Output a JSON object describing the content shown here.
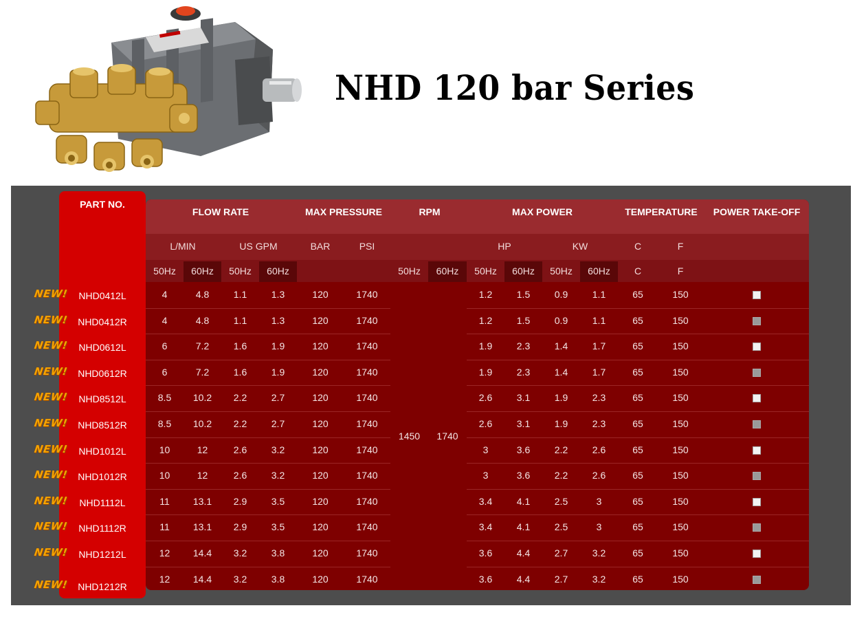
{
  "title": "NHD 120 bar Series",
  "badge": "NEW!",
  "headers": {
    "part_no": "PART NO.",
    "flow_rate": "FLOW RATE",
    "max_pressure": "MAX PRESSURE",
    "rpm": "RPM",
    "max_power": "MAX POWER",
    "temperature": "TEMPERATURE",
    "power_take_off": "POWER TAKE-OFF"
  },
  "units": {
    "lmin": "L/MIN",
    "usgpm": "US GPM",
    "bar": "BAR",
    "psi": "PSI",
    "hp": "HP",
    "kw": "KW",
    "c": "C",
    "f": "F"
  },
  "freq": {
    "hz50": "50Hz",
    "hz60": "60Hz"
  },
  "rpm_values": {
    "hz50": "1450",
    "hz60": "1740"
  },
  "colors": {
    "accent_red": "#d40000",
    "table_red": "#7e0000",
    "badge": "#f5a300"
  },
  "rows": [
    {
      "part": "NHD0412L",
      "lmin50": "4",
      "lmin60": "4.8",
      "gpm50": "1.1",
      "gpm60": "1.3",
      "bar": "120",
      "psi": "1740",
      "hp50": "1.2",
      "hp60": "1.5",
      "kw50": "0.9",
      "kw60": "1.1",
      "c": "65",
      "f": "150",
      "pto": "white"
    },
    {
      "part": "NHD0412R",
      "lmin50": "4",
      "lmin60": "4.8",
      "gpm50": "1.1",
      "gpm60": "1.3",
      "bar": "120",
      "psi": "1740",
      "hp50": "1.2",
      "hp60": "1.5",
      "kw50": "0.9",
      "kw60": "1.1",
      "c": "65",
      "f": "150",
      "pto": "gray"
    },
    {
      "part": "NHD0612L",
      "lmin50": "6",
      "lmin60": "7.2",
      "gpm50": "1.6",
      "gpm60": "1.9",
      "bar": "120",
      "psi": "1740",
      "hp50": "1.9",
      "hp60": "2.3",
      "kw50": "1.4",
      "kw60": "1.7",
      "c": "65",
      "f": "150",
      "pto": "white"
    },
    {
      "part": "NHD0612R",
      "lmin50": "6",
      "lmin60": "7.2",
      "gpm50": "1.6",
      "gpm60": "1.9",
      "bar": "120",
      "psi": "1740",
      "hp50": "1.9",
      "hp60": "2.3",
      "kw50": "1.4",
      "kw60": "1.7",
      "c": "65",
      "f": "150",
      "pto": "gray"
    },
    {
      "part": "NHD8512L",
      "lmin50": "8.5",
      "lmin60": "10.2",
      "gpm50": "2.2",
      "gpm60": "2.7",
      "bar": "120",
      "psi": "1740",
      "hp50": "2.6",
      "hp60": "3.1",
      "kw50": "1.9",
      "kw60": "2.3",
      "c": "65",
      "f": "150",
      "pto": "white"
    },
    {
      "part": "NHD8512R",
      "lmin50": "8.5",
      "lmin60": "10.2",
      "gpm50": "2.2",
      "gpm60": "2.7",
      "bar": "120",
      "psi": "1740",
      "hp50": "2.6",
      "hp60": "3.1",
      "kw50": "1.9",
      "kw60": "2.3",
      "c": "65",
      "f": "150",
      "pto": "gray"
    },
    {
      "part": "NHD1012L",
      "lmin50": "10",
      "lmin60": "12",
      "gpm50": "2.6",
      "gpm60": "3.2",
      "bar": "120",
      "psi": "1740",
      "hp50": "3",
      "hp60": "3.6",
      "kw50": "2.2",
      "kw60": "2.6",
      "c": "65",
      "f": "150",
      "pto": "white"
    },
    {
      "part": "NHD1012R",
      "lmin50": "10",
      "lmin60": "12",
      "gpm50": "2.6",
      "gpm60": "3.2",
      "bar": "120",
      "psi": "1740",
      "hp50": "3",
      "hp60": "3.6",
      "kw50": "2.2",
      "kw60": "2.6",
      "c": "65",
      "f": "150",
      "pto": "gray"
    },
    {
      "part": "NHD1112L",
      "lmin50": "11",
      "lmin60": "13.1",
      "gpm50": "2.9",
      "gpm60": "3.5",
      "bar": "120",
      "psi": "1740",
      "hp50": "3.4",
      "hp60": "4.1",
      "kw50": "2.5",
      "kw60": "3",
      "c": "65",
      "f": "150",
      "pto": "white"
    },
    {
      "part": "NHD1112R",
      "lmin50": "11",
      "lmin60": "13.1",
      "gpm50": "2.9",
      "gpm60": "3.5",
      "bar": "120",
      "psi": "1740",
      "hp50": "3.4",
      "hp60": "4.1",
      "kw50": "2.5",
      "kw60": "3",
      "c": "65",
      "f": "150",
      "pto": "gray"
    },
    {
      "part": "NHD1212L",
      "lmin50": "12",
      "lmin60": "14.4",
      "gpm50": "3.2",
      "gpm60": "3.8",
      "bar": "120",
      "psi": "1740",
      "hp50": "3.6",
      "hp60": "4.4",
      "kw50": "2.7",
      "kw60": "3.2",
      "c": "65",
      "f": "150",
      "pto": "white"
    },
    {
      "part": "NHD1212R",
      "lmin50": "12",
      "lmin60": "14.4",
      "gpm50": "3.2",
      "gpm60": "3.8",
      "bar": "120",
      "psi": "1740",
      "hp50": "3.6",
      "hp60": "4.4",
      "kw50": "2.7",
      "kw60": "3.2",
      "c": "65",
      "f": "150",
      "pto": "gray"
    }
  ]
}
